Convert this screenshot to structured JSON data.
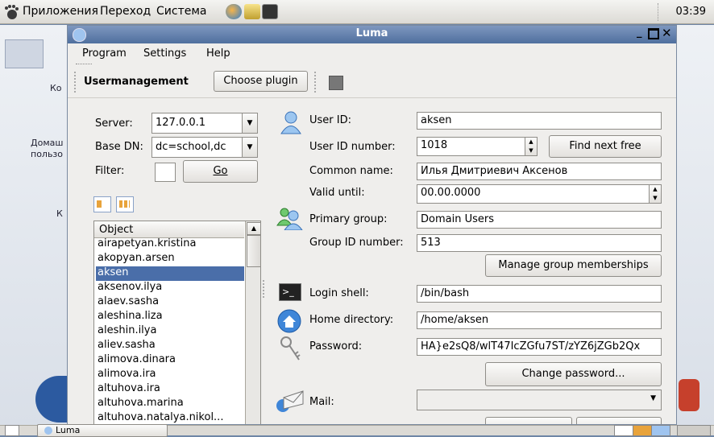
{
  "top_panel": {
    "applications": "Приложения",
    "places": "Переход",
    "system": "Система",
    "clock": "03:39"
  },
  "desktop": {
    "labels": [
      "Ко",
      "Домаш",
      "пользо",
      "К"
    ]
  },
  "window": {
    "title": "Luma",
    "menu": {
      "program": "Program",
      "settings": "Settings",
      "help": "Help"
    },
    "toolbar": {
      "plugin_name": "Usermanagement",
      "choose_plugin": "Choose plugin"
    },
    "left": {
      "server_label": "Server:",
      "server_value": "127.0.0.1",
      "basedn_label": "Base DN:",
      "basedn_value": "dc=school,dc",
      "filter_label": "Filter:",
      "filter_value": "",
      "go_label": "Go",
      "list_header": "Object",
      "items": [
        "airapetyan.kristina",
        "akopyan.arsen",
        "aksen",
        "aksenov.ilya",
        "alaev.sasha",
        "aleshina.liza",
        "aleshin.ilya",
        "aliev.sasha",
        "alimova.dinara",
        "alimova.ira",
        "altuhova.ira",
        "altuhova.marina",
        "altuhova.natalya.nikol..."
      ],
      "selected_item": "aksen"
    },
    "form": {
      "user_id_label": "User ID:",
      "user_id": "aksen",
      "uid_number_label": "User ID number:",
      "uid_number": "1018",
      "find_next_free": "Find next free",
      "common_name_label": "Common name:",
      "common_name": "Илья Дмитриевич Аксенов",
      "valid_until_label": "Valid until:",
      "valid_until": "00.00.0000",
      "primary_group_label": "Primary group:",
      "primary_group": "Domain Users",
      "gid_number_label": "Group ID number:",
      "gid_number": "513",
      "manage_groups": "Manage group memberships",
      "login_shell_label": "Login shell:",
      "login_shell": "/bin/bash",
      "home_dir_label": "Home directory:",
      "home_dir": "/home/aksen",
      "password_label": "Password:",
      "password": "HA}e2sQ8/wlT47IcZGfu7ST/zYZ6jZGb2Qx",
      "change_password": "Change password...",
      "mail_label": "Mail:",
      "mail": ""
    }
  },
  "bottom_panel": {
    "task": "Luma"
  },
  "colors": {
    "titlebar": "#5b79a8",
    "selection": "#4a6ea9",
    "panel": "#dcdad5"
  }
}
